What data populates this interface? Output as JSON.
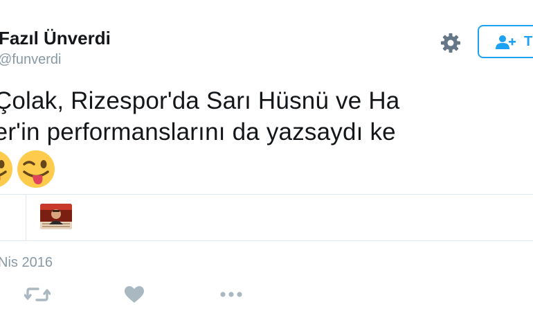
{
  "tweet": {
    "display_name": "Fazıl Ünverdi",
    "handle": "@funverdi",
    "follow_label": "T",
    "text_line1": "ı Çolak, Rizespor'da Sarı Hüsnü ve Ha",
    "text_line2": "her'in performanslarını da yazsaydı ke",
    "date": "Nis 2016"
  },
  "icons": {
    "settings": "gear-icon",
    "follow": "add-user-icon",
    "emoji": "winking-face-with-tongue-emoji",
    "retweet": "retweet-icon",
    "like": "heart-icon",
    "more": "more-icon"
  },
  "colors": {
    "accent": "#1da1f2",
    "muted": "#8899a6",
    "icon": "#aab8c2",
    "divider": "#e1e8ed",
    "emoji_face": "#ffcb4c",
    "tongue": "#e0445a"
  }
}
